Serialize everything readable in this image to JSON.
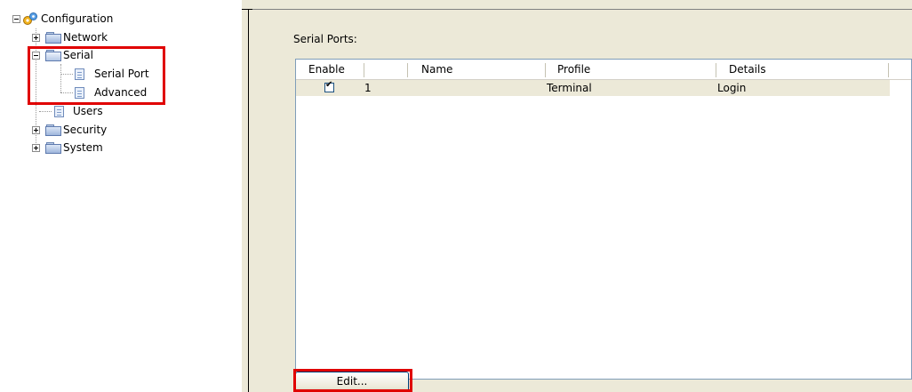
{
  "tree": {
    "root_label": "Configuration",
    "items": [
      {
        "label": "Network"
      },
      {
        "label": "Serial"
      },
      {
        "label": "Serial Port"
      },
      {
        "label": "Advanced"
      },
      {
        "label": "Users"
      },
      {
        "label": "Security"
      },
      {
        "label": "System"
      }
    ]
  },
  "panel": {
    "title": "Serial Ports:",
    "columns": [
      "Enable",
      "Name",
      "Profile",
      "Details"
    ],
    "rows": [
      {
        "enabled": true,
        "number": "1",
        "name": "",
        "profile": "Terminal",
        "details": "Login"
      }
    ],
    "edit_button": "Edit..."
  },
  "colors": {
    "highlight_box": "#e00000",
    "panel_bg": "#ece9d8",
    "selected_row_bg": "#ece9d8"
  },
  "icons": {
    "root": "configuration-icon",
    "folder": "folder-icon",
    "page": "page-icon",
    "expand": "plus-box-icon",
    "collapse": "minus-box-icon"
  }
}
